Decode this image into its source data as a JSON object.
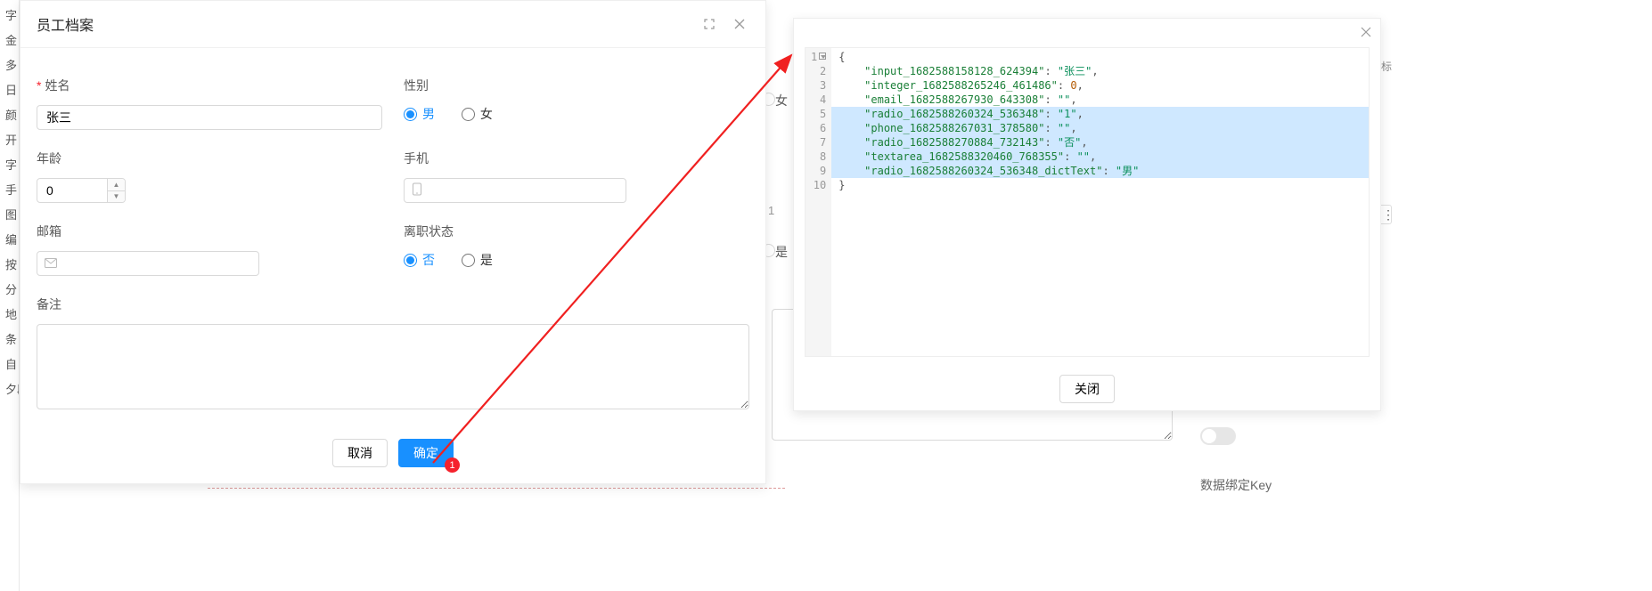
{
  "left_edge_items": [
    "字",
    "金",
    "多",
    "日",
    "颜",
    "开",
    "字",
    "手",
    "图",
    "编",
    "按",
    "分",
    "地",
    "条",
    "自",
    "夕段"
  ],
  "form": {
    "title": "员工档案",
    "name": {
      "label": "姓名",
      "value": "张三",
      "required": true
    },
    "gender": {
      "label": "性别",
      "option_male": "男",
      "option_female": "女",
      "selected": "男"
    },
    "age": {
      "label": "年龄",
      "value": "0"
    },
    "phone": {
      "label": "手机",
      "value": ""
    },
    "email": {
      "label": "邮箱",
      "value": ""
    },
    "leave": {
      "label": "离职状态",
      "option_no": "否",
      "option_yes": "是",
      "selected": "否"
    },
    "remark": {
      "label": "备注",
      "value": ""
    },
    "btn_cancel": "取消",
    "btn_ok": "确定",
    "badge": "1"
  },
  "peek": {
    "female": "女",
    "yes": "是",
    "label_bottom": "数据绑定Key",
    "label_far": "标",
    "dot": "1"
  },
  "json_panel": {
    "close_btn": "关闭",
    "lines": [
      {
        "n": "1",
        "fold": true,
        "text_tokens": [
          [
            "p",
            "{"
          ]
        ]
      },
      {
        "n": "2",
        "text_tokens": [
          [
            "p",
            "    "
          ],
          [
            "k",
            "\"input_1682588158128_624394\""
          ],
          [
            "p",
            ": "
          ],
          [
            "s",
            "\"张三\""
          ],
          [
            "p",
            ","
          ]
        ]
      },
      {
        "n": "3",
        "text_tokens": [
          [
            "p",
            "    "
          ],
          [
            "k",
            "\"integer_1682588265246_461486\""
          ],
          [
            "p",
            ": "
          ],
          [
            "n",
            "0"
          ],
          [
            "p",
            ","
          ]
        ]
      },
      {
        "n": "4",
        "text_tokens": [
          [
            "p",
            "    "
          ],
          [
            "k",
            "\"email_1682588267930_643308\""
          ],
          [
            "p",
            ": "
          ],
          [
            "s",
            "\"\""
          ],
          [
            "p",
            ","
          ]
        ]
      },
      {
        "n": "5",
        "hl": true,
        "text_tokens": [
          [
            "p",
            "    "
          ],
          [
            "k",
            "\"radio_1682588260324_536348\""
          ],
          [
            "p",
            ": "
          ],
          [
            "s",
            "\"1\""
          ],
          [
            "p",
            ","
          ]
        ]
      },
      {
        "n": "6",
        "hl": true,
        "text_tokens": [
          [
            "p",
            "    "
          ],
          [
            "k",
            "\"phone_1682588267031_378580\""
          ],
          [
            "p",
            ": "
          ],
          [
            "s",
            "\"\""
          ],
          [
            "p",
            ","
          ]
        ]
      },
      {
        "n": "7",
        "hl": true,
        "text_tokens": [
          [
            "p",
            "    "
          ],
          [
            "k",
            "\"radio_1682588270884_732143\""
          ],
          [
            "p",
            ": "
          ],
          [
            "s",
            "\"否\""
          ],
          [
            "p",
            ","
          ]
        ]
      },
      {
        "n": "8",
        "hl": true,
        "text_tokens": [
          [
            "p",
            "    "
          ],
          [
            "k",
            "\"textarea_1682588320460_768355\""
          ],
          [
            "p",
            ": "
          ],
          [
            "s",
            "\"\""
          ],
          [
            "p",
            ","
          ]
        ]
      },
      {
        "n": "9",
        "hl": true,
        "text_tokens": [
          [
            "p",
            "    "
          ],
          [
            "k",
            "\"radio_1682588260324_536348_dictText\""
          ],
          [
            "p",
            ": "
          ],
          [
            "s",
            "\"男\""
          ]
        ]
      },
      {
        "n": "10",
        "text_tokens": [
          [
            "p",
            "}"
          ]
        ]
      }
    ]
  }
}
